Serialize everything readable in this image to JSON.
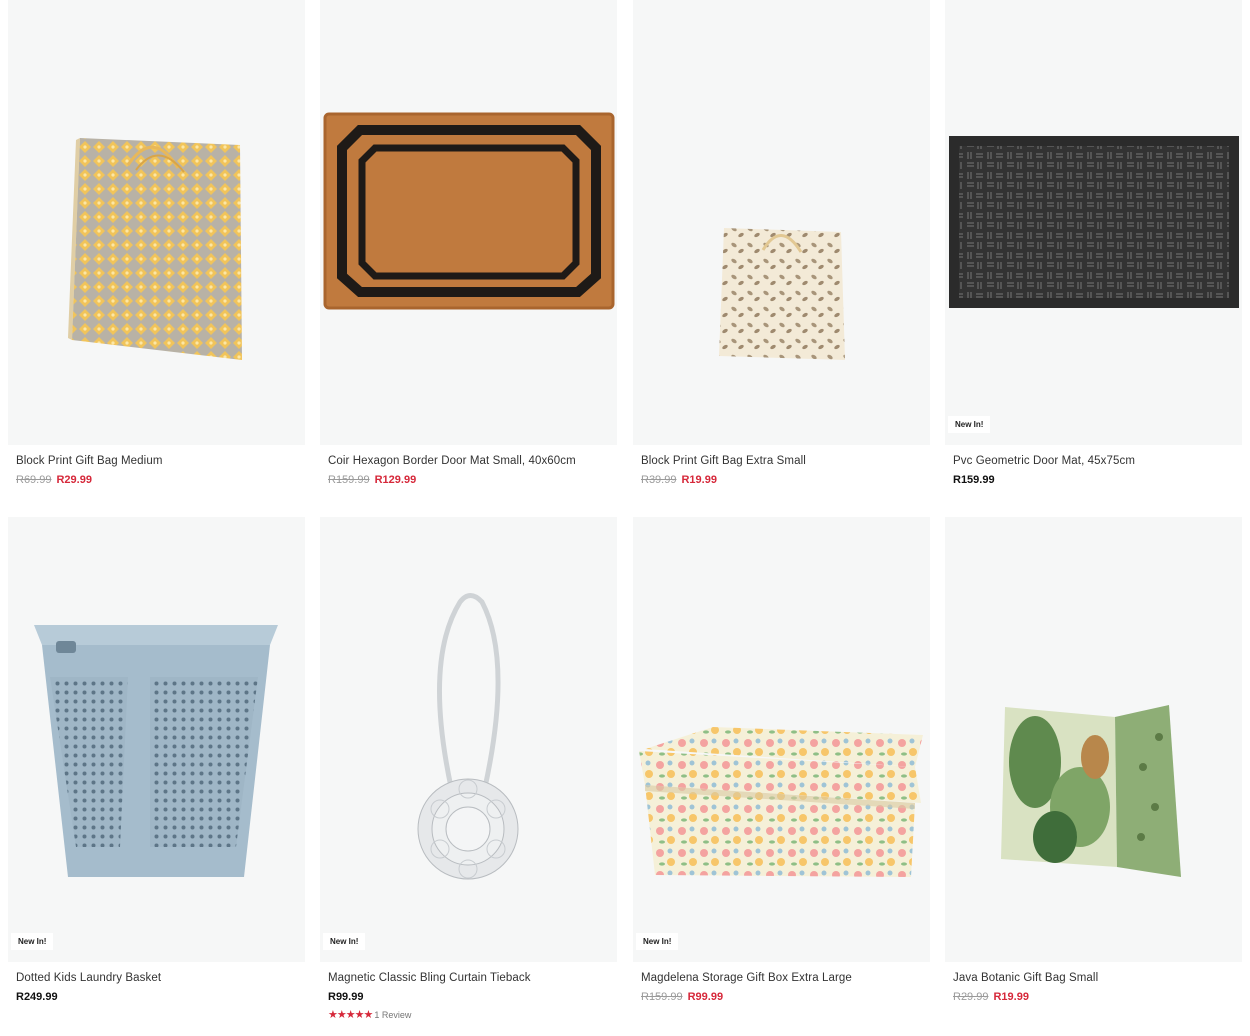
{
  "products": [
    {
      "name": "Block Print Gift Bag Medium",
      "was": "R69.99",
      "price": "R29.99",
      "badge": ""
    },
    {
      "name": "Coir Hexagon Border Door Mat Small, 40x60cm",
      "was": "R159.99",
      "price": "R129.99",
      "badge": ""
    },
    {
      "name": "Block Print Gift Bag Extra Small",
      "was": "R39.99",
      "price": "R19.99",
      "badge": ""
    },
    {
      "name": "Pvc Geometric Door Mat, 45x75cm",
      "was": "",
      "price": "R159.99",
      "badge": "New In!"
    },
    {
      "name": "Dotted Kids Laundry Basket",
      "was": "",
      "price": "R249.99",
      "badge": "New In!"
    },
    {
      "name": "Magnetic Classic Bling Curtain Tieback",
      "was": "",
      "price": "R99.99",
      "badge": "New In!",
      "stars": "★★★★★",
      "rating_value": 5,
      "reviews": "1 Review"
    },
    {
      "name": "Magdelena Storage Gift Box Extra Large",
      "was": "R159.99",
      "price": "R99.99",
      "badge": "New In!"
    },
    {
      "name": "Java Botanic Gift Bag Small",
      "was": "R29.99",
      "price": "R19.99",
      "badge": ""
    }
  ],
  "colors": {
    "sale": "#d6283a",
    "image_bg": "#f6f7f7"
  }
}
